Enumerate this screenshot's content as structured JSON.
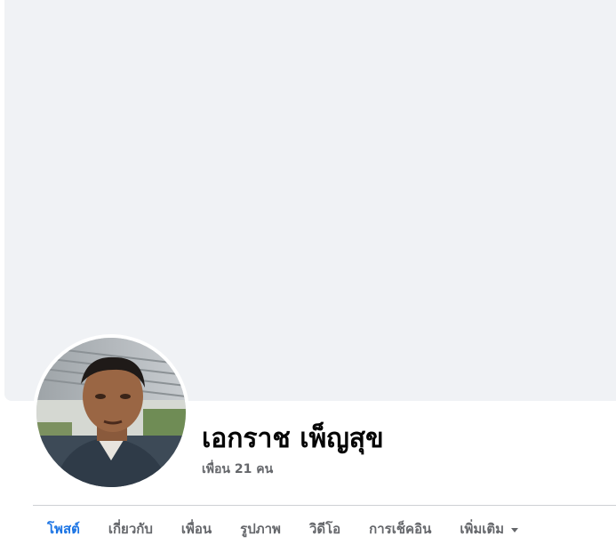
{
  "profile": {
    "name": "เอกราช เพ็ญสุข",
    "friends_label": "เพื่อน 21 คน"
  },
  "tabs": [
    {
      "label": "โพสต์",
      "active": true
    },
    {
      "label": "เกี่ยวกับ",
      "active": false
    },
    {
      "label": "เพื่อน",
      "active": false
    },
    {
      "label": "รูปภาพ",
      "active": false
    },
    {
      "label": "วิดีโอ",
      "active": false
    },
    {
      "label": "การเช็คอิน",
      "active": false
    },
    {
      "label": "เพิ่มเติม",
      "active": false,
      "icon": "caret-down-icon"
    }
  ],
  "colors": {
    "cover_background": "#f0f2f5",
    "active_tab": "#1b74e4",
    "inactive_tab": "#65676b"
  }
}
